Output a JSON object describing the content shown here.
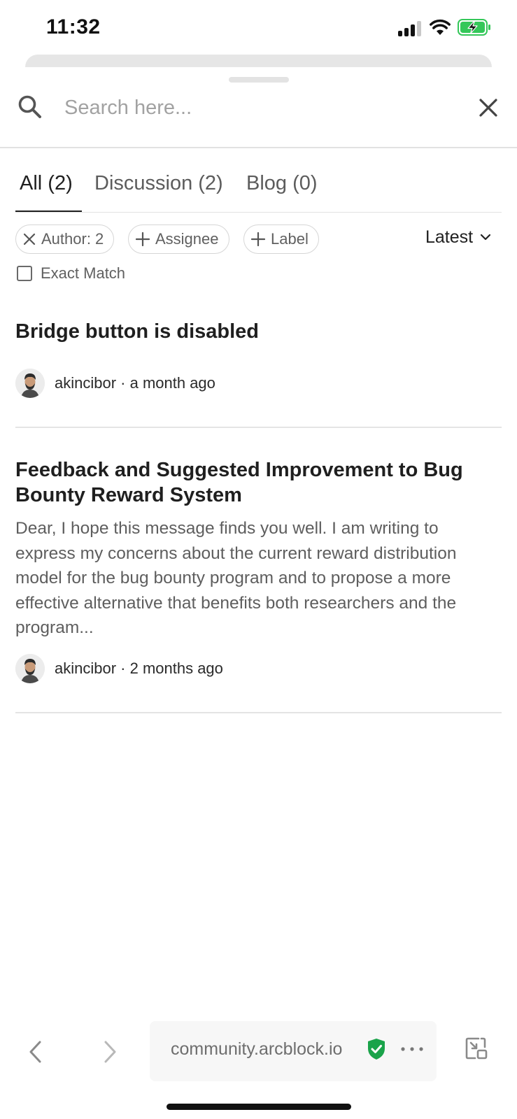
{
  "status_bar": {
    "time": "11:32"
  },
  "search": {
    "placeholder": "Search here..."
  },
  "tabs": [
    {
      "label": "All (2)",
      "active": true
    },
    {
      "label": "Discussion (2)",
      "active": false
    },
    {
      "label": "Blog (0)",
      "active": false
    }
  ],
  "filters": {
    "author_chip": "Author: 2",
    "assignee_chip": "Assignee",
    "label_chip": "Label",
    "sort_label": "Latest",
    "exact_match_label": "Exact Match",
    "exact_match_checked": false
  },
  "posts": [
    {
      "title": "Bridge button is disabled",
      "excerpt": "",
      "author": "akincibor",
      "meta": "akincibor · a month ago"
    },
    {
      "title": "Feedback and Suggested Improvement to Bug Bounty Reward System",
      "excerpt": "Dear, I hope this message finds you well. I am writing to express my concerns about the current reward distribution model for the bug bounty program and to propose a more effective alternative that benefits both researchers and the program...",
      "author": "akincibor",
      "meta": "akincibor · 2 months ago"
    }
  ],
  "browser": {
    "url": "community.arcblock.io",
    "secure_color": "#1aa34a"
  },
  "colors": {
    "battery_charging": "#34c759"
  }
}
